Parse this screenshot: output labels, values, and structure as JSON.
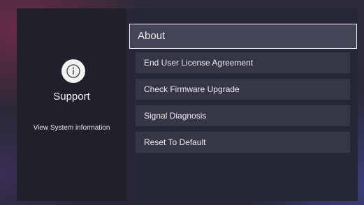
{
  "sidebar": {
    "icon": "info-circle-icon",
    "title": "Support",
    "description": "View System information"
  },
  "menu": {
    "selected_index": 0,
    "items": [
      {
        "label": "About"
      },
      {
        "label": "End User License Agreement"
      },
      {
        "label": "Check Firmware Upgrade"
      },
      {
        "label": "Signal Diagnosis"
      },
      {
        "label": "Reset To Default"
      }
    ]
  },
  "colors": {
    "panel": "#262736",
    "sidebar": "#20202b",
    "item": "#363746",
    "item_selected": "#434556",
    "focus_border": "#f4f4f6"
  }
}
